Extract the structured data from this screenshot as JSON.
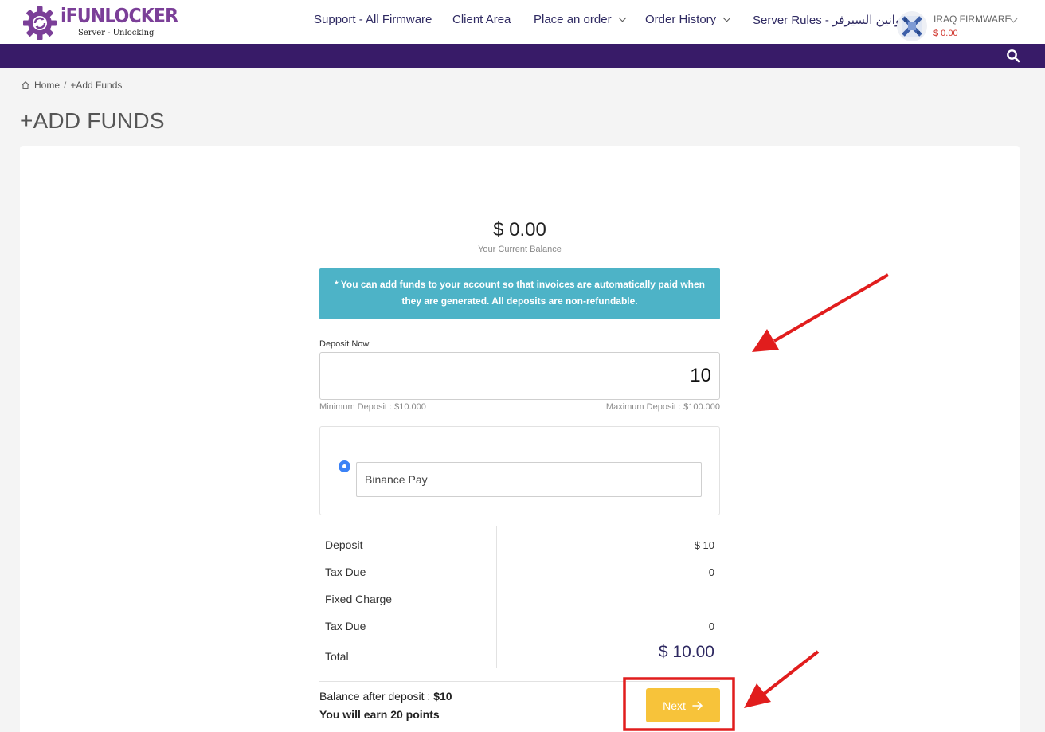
{
  "logo": {
    "word": "iFUNLOCKER",
    "subtitle": "Server - Unlocking"
  },
  "nav": {
    "items": [
      {
        "label": "Support - All Firmware",
        "dropdown": false
      },
      {
        "label": "Client Area",
        "dropdown": false
      },
      {
        "label": "Place an order",
        "dropdown": true
      },
      {
        "label": "Order History",
        "dropdown": true
      },
      {
        "label": "Server Rules - قوانين السيرفر",
        "dropdown": false
      }
    ]
  },
  "account": {
    "name": "IRAQ FIRMWARE",
    "balance": "$ 0.00"
  },
  "breadcrumb": {
    "home": "Home",
    "separator": "/",
    "current": "+Add Funds"
  },
  "page": {
    "title": "+ADD FUNDS"
  },
  "balance": {
    "amount": "$ 0.00",
    "label": "Your Current Balance"
  },
  "info_message": "* You can add funds to your account so that invoices are automatically paid when they are generated. All deposits are non-refundable.",
  "deposit": {
    "label": "Deposit Now",
    "value": "10",
    "min_text": "Minimum Deposit : $10.000",
    "max_text": "Maximum Deposit : $100.000"
  },
  "payment": {
    "selected": "Binance Pay"
  },
  "summary": {
    "rows": [
      {
        "label": "Deposit",
        "value": "$ 10"
      },
      {
        "label": "Tax Due",
        "value": "0"
      },
      {
        "label": "Fixed Charge",
        "value": ""
      },
      {
        "label": "Tax Due",
        "value": "0"
      }
    ],
    "total_label": "Total",
    "total_value": "$ 10.00"
  },
  "footer": {
    "balance_after_label": "Balance after deposit :",
    "balance_after_value": "$10",
    "points_text": "You will earn 20 points"
  },
  "next_button": {
    "label": "Next"
  },
  "colors": {
    "brand_purple": "#7b3f98",
    "nav_bar": "#381b68",
    "info_box": "#4db3c7",
    "next_button": "#f7c33a",
    "annotation_red": "#e11d1d",
    "radio_blue": "#3b82f6"
  },
  "icons": [
    "gear-logo-icon",
    "chevron-down-icon",
    "avatar-icon",
    "search-icon",
    "home-icon",
    "arrow-right-icon"
  ]
}
